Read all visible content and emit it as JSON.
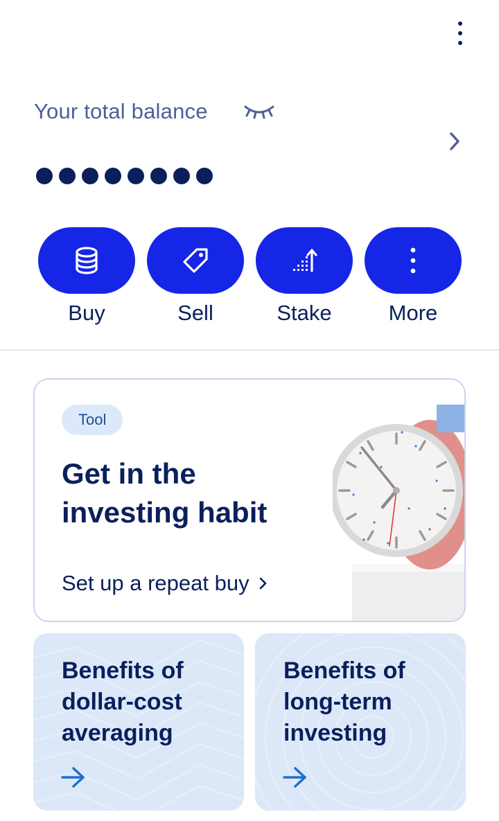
{
  "header": {
    "menu_icon": "vertical-ellipsis-icon"
  },
  "balance": {
    "label": "Your total balance",
    "hidden_digits": 8,
    "visibility_icon": "eye-closed-icon",
    "chevron_icon": "chevron-right-icon"
  },
  "actions": [
    {
      "label": "Buy",
      "icon": "coins-stack-icon"
    },
    {
      "label": "Sell",
      "icon": "price-tag-icon"
    },
    {
      "label": "Stake",
      "icon": "stake-arrow-up-icon"
    },
    {
      "label": "More",
      "icon": "vertical-ellipsis-icon"
    }
  ],
  "promo": {
    "badge": "Tool",
    "title": "Get in the investing habit",
    "link_label": "Set up a repeat buy",
    "image": "clock-illustration"
  },
  "cards": [
    {
      "title": "Benefits of dollar-cost averaging",
      "icon": "arrow-right-icon"
    },
    {
      "title": "Benefits of long-term investing",
      "icon": "arrow-right-icon"
    }
  ],
  "colors": {
    "primary": "#1626e6",
    "text_dark": "#0a1f5c",
    "text_muted": "#4e5f96",
    "card_bg": "#dce8f8",
    "badge_bg": "#dbe9fb"
  }
}
